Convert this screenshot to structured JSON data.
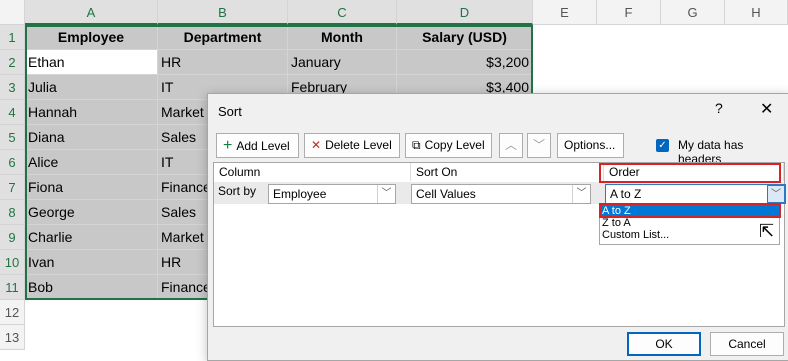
{
  "sheet": {
    "columns": [
      "A",
      "B",
      "C",
      "D",
      "E",
      "F",
      "G",
      "H"
    ],
    "rows": [
      "1",
      "2",
      "3",
      "4",
      "5",
      "6",
      "7",
      "8",
      "9",
      "10",
      "11",
      "12",
      "13"
    ],
    "headers": [
      "Employee",
      "Department",
      "Month",
      "Salary (USD)"
    ],
    "data": [
      [
        "Ethan",
        "HR",
        "January",
        "$3,200"
      ],
      [
        "Julia",
        "IT",
        "February",
        "$3,400"
      ],
      [
        "Hannah",
        "Market",
        "",
        ""
      ],
      [
        "Diana",
        "Sales",
        "",
        ""
      ],
      [
        "Alice",
        "IT",
        "",
        ""
      ],
      [
        "Fiona",
        "Finance",
        "",
        ""
      ],
      [
        "George",
        "Sales",
        "",
        ""
      ],
      [
        "Charlie",
        "Market",
        "",
        ""
      ],
      [
        "Ivan",
        "HR",
        "",
        ""
      ],
      [
        "Bob",
        "Finance",
        "",
        ""
      ]
    ]
  },
  "dialog": {
    "title": "Sort",
    "help": "?",
    "close": "✕",
    "toolbar": {
      "add_level": "Add Level",
      "delete_level": "Delete Level",
      "copy_level": "Copy Level",
      "options": "Options...",
      "my_data_has_headers": "My data has headers",
      "my_data_has_headers_checked": true
    },
    "grid": {
      "col_column": "Column",
      "col_sort_on": "Sort On",
      "col_order": "Order",
      "sort_by_label": "Sort by",
      "column_value": "Employee",
      "sort_on_value": "Cell Values",
      "order_value": "A to Z"
    },
    "order_options": [
      "A to Z",
      "Z to A",
      "Custom List..."
    ],
    "ok": "OK",
    "cancel": "Cancel"
  },
  "colors": {
    "selection_green": "#217346",
    "data_fill": "#c8c8c8",
    "highlight_blue": "#0078d7",
    "annotation_red": "#d92323"
  }
}
